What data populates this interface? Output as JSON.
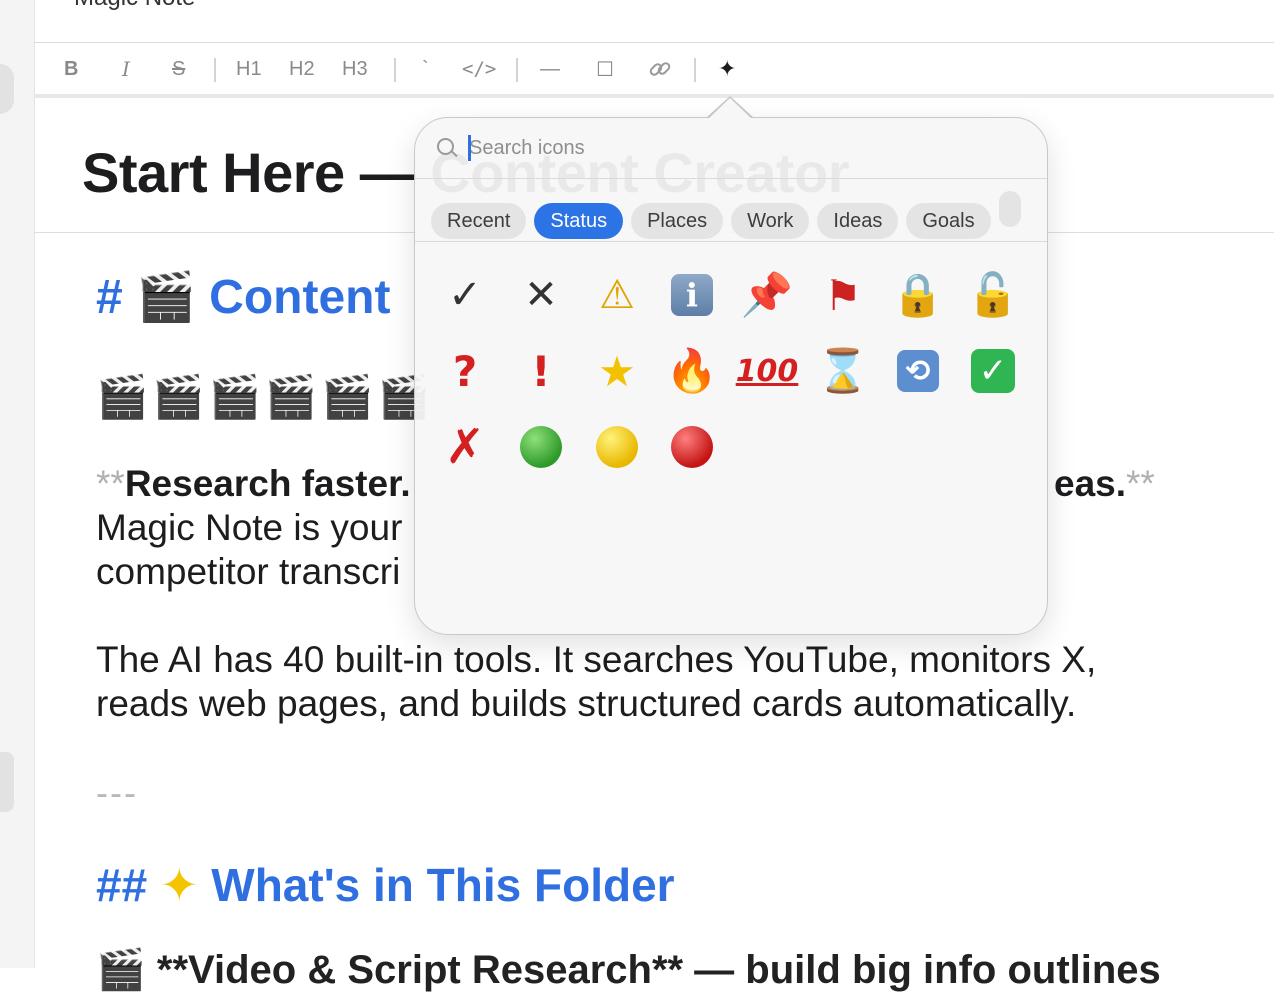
{
  "window": {
    "title": "Magic Note"
  },
  "toolbar": {
    "bold": "B",
    "italic": "I",
    "strike": "S",
    "h1": "H1",
    "h2": "H2",
    "h3": "H3",
    "inline_code": "`",
    "code_block": "</>",
    "rule": "—",
    "checkbox": "☐",
    "link_icon": "link-icon",
    "icon_picker": "✦"
  },
  "document": {
    "title": "Start Here — Content Creator",
    "h1_marker": "#",
    "h1_emoji": "🎬",
    "h1_text": "Content",
    "clapper_row": "🎬🎬🎬🎬🎬🎬",
    "para1_open": "**",
    "para1_bold": "Research faster.",
    "para1_bold_end": "eas.",
    "para1_close": "**",
    "para1_line2": "Magic Note is your",
    "para1_line3": "competitor transcri",
    "para2_line1": "The AI has 40 built-in tools. It searches YouTube, monitors X,",
    "para2_line2": "reads web pages, and builds structured cards automatically.",
    "hr": "---",
    "h2_marker": "##",
    "h2_emoji": "✦",
    "h2_text": "What's in This Folder",
    "cut_line": "🎬 **Video & Script Research** — build big info outlines"
  },
  "icon_picker": {
    "search_placeholder": "Search icons",
    "search_value": "",
    "tabs": [
      "Recent",
      "Status",
      "Places",
      "Work",
      "Ideas",
      "Goals"
    ],
    "active_tab": "Status",
    "icons": [
      {
        "name": "checkmark",
        "glyph": "✓"
      },
      {
        "name": "xmark",
        "glyph": "✕"
      },
      {
        "name": "warning",
        "glyph": "⚠"
      },
      {
        "name": "info",
        "glyph": "i"
      },
      {
        "name": "pushpin",
        "glyph": "📌"
      },
      {
        "name": "red-flag",
        "glyph": "⚑"
      },
      {
        "name": "lock",
        "glyph": "🔒"
      },
      {
        "name": "unlock",
        "glyph": "🔓"
      },
      {
        "name": "question",
        "glyph": "?"
      },
      {
        "name": "exclamation",
        "glyph": "!"
      },
      {
        "name": "star",
        "glyph": "★"
      },
      {
        "name": "fire",
        "glyph": "🔥"
      },
      {
        "name": "hundred",
        "glyph": "100"
      },
      {
        "name": "hourglass",
        "glyph": "⌛"
      },
      {
        "name": "repeat",
        "glyph": "⟲"
      },
      {
        "name": "check-box",
        "glyph": "✓"
      },
      {
        "name": "cross-mark",
        "glyph": "✗"
      },
      {
        "name": "green-circle",
        "glyph": ""
      },
      {
        "name": "yellow-circle",
        "glyph": ""
      },
      {
        "name": "red-circle",
        "glyph": ""
      }
    ]
  },
  "colors": {
    "accent": "#2c73e6",
    "heading": "#2f6fe0",
    "text": "#1d1d1f"
  }
}
